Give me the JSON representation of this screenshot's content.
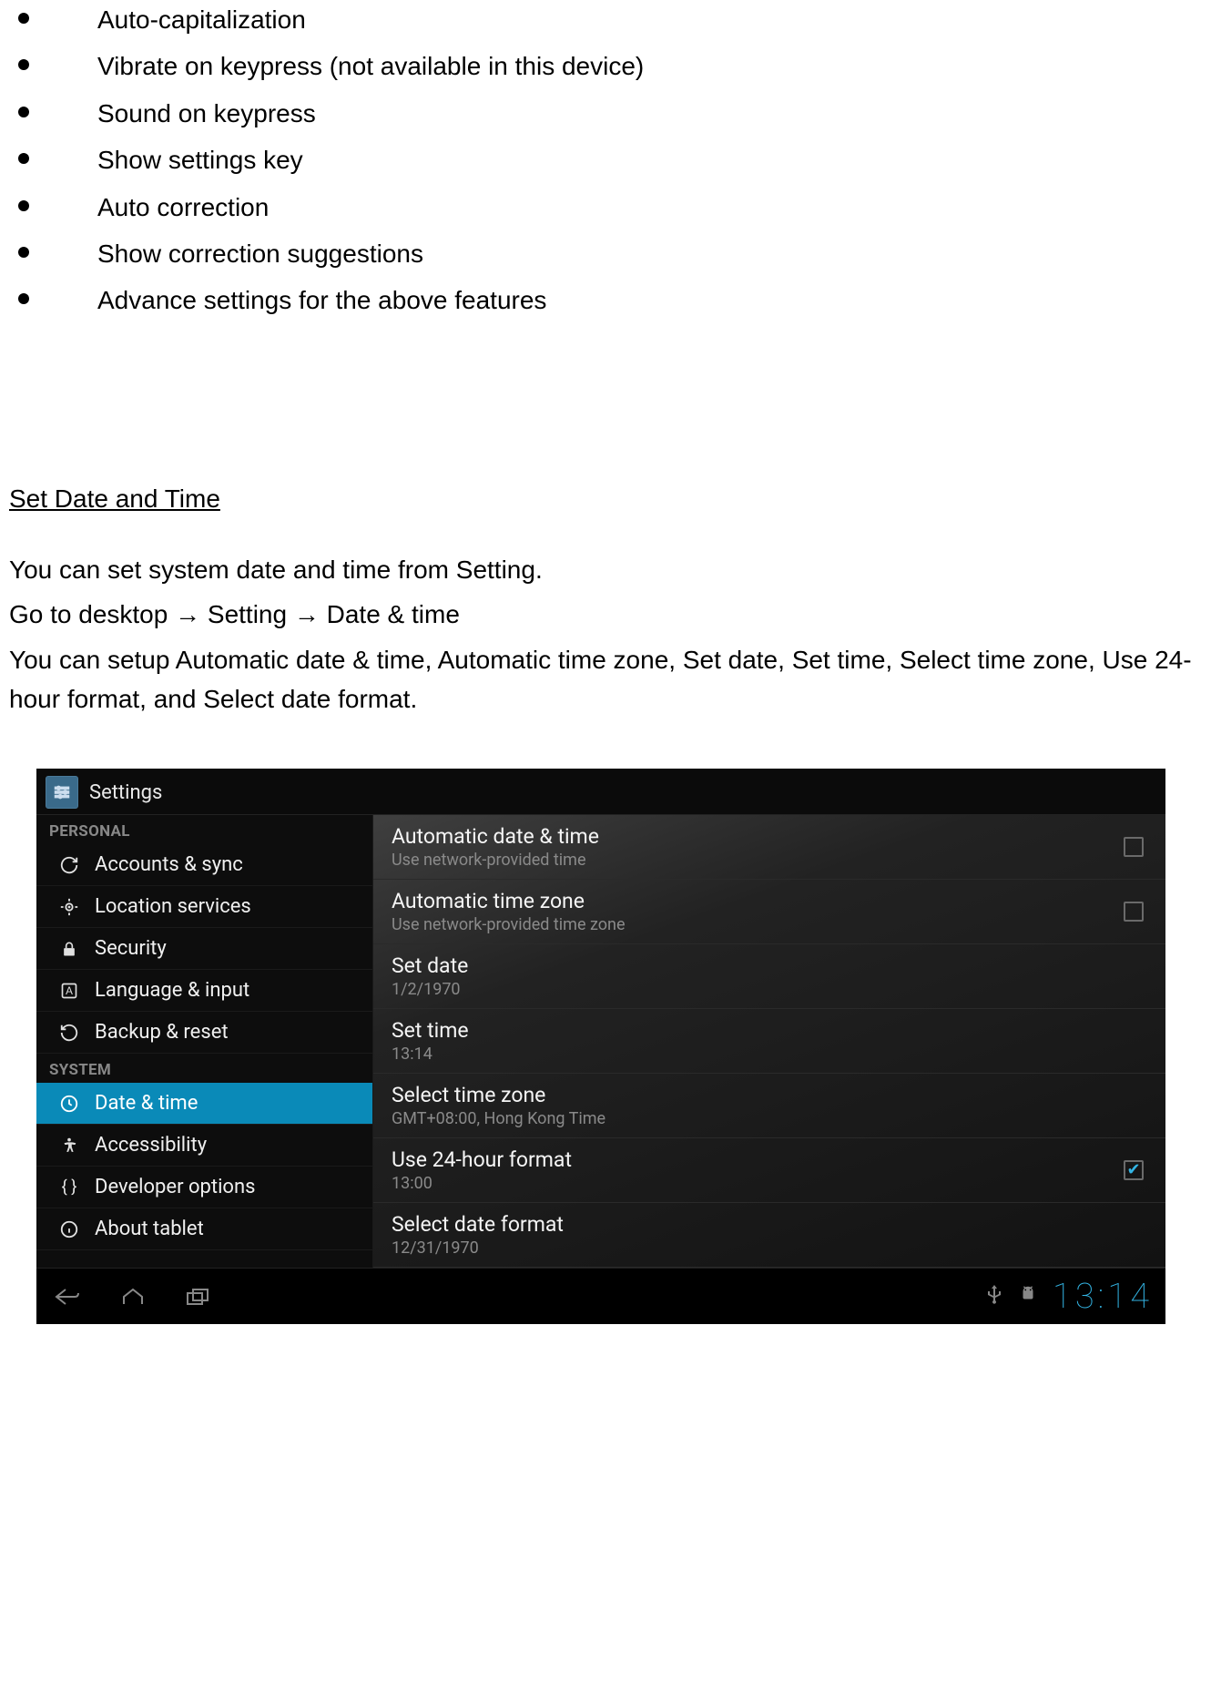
{
  "bullets": [
    "Auto-capitalization",
    "Vibrate on keypress (not available in this device)",
    "Sound on keypress",
    "Show settings key",
    "Auto correction",
    "Show correction suggestions",
    "Advance settings for the above features"
  ],
  "section_heading": "Set Date and Time",
  "paragraphs": {
    "p1": "You can set system date and time from Setting.",
    "p2": "Go to desktop → Setting → Date & time",
    "p3": "You can setup Automatic date & time, Automatic time zone, Set date, Set time, Select time zone, Use 24-hour format, and Select date format."
  },
  "screenshot": {
    "header_title": "Settings",
    "sidebar": {
      "personal_label": "PERSONAL",
      "system_label": "SYSTEM",
      "items": {
        "accounts": "Accounts & sync",
        "location": "Location services",
        "security": "Security",
        "language": "Language & input",
        "backup": "Backup & reset",
        "datetime": "Date & time",
        "accessibility": "Accessibility",
        "developer": "Developer options",
        "about": "About tablet"
      }
    },
    "settings": {
      "auto_date": {
        "title": "Automatic date & time",
        "sub": "Use network-provided time",
        "checked": false
      },
      "auto_tz": {
        "title": "Automatic time zone",
        "sub": "Use network-provided time zone",
        "checked": false
      },
      "set_date": {
        "title": "Set date",
        "sub": "1/2/1970"
      },
      "set_time": {
        "title": "Set time",
        "sub": "13:14"
      },
      "select_tz": {
        "title": "Select time zone",
        "sub": "GMT+08:00, Hong Kong Time"
      },
      "use_24h": {
        "title": "Use 24-hour format",
        "sub": "13:00",
        "checked": true
      },
      "date_fmt": {
        "title": "Select date format",
        "sub": "12/31/1970"
      }
    },
    "navbar": {
      "clock": "13:14"
    }
  }
}
